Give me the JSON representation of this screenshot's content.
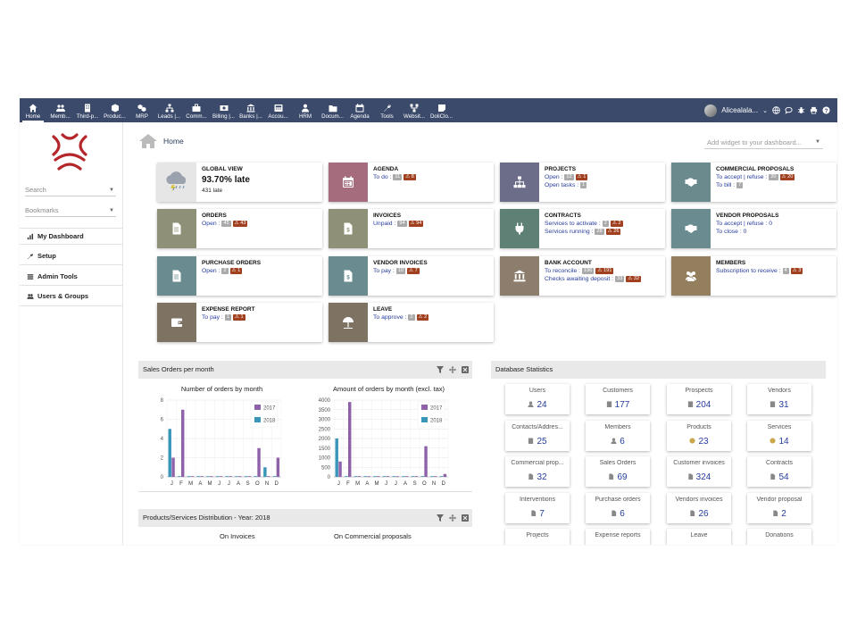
{
  "menu": [
    {
      "label": "Home",
      "icon": "home-icon",
      "active": true
    },
    {
      "label": "Memb...",
      "icon": "members-icon"
    },
    {
      "label": "Third-p...",
      "icon": "building-icon"
    },
    {
      "label": "Produc...",
      "icon": "cube-icon"
    },
    {
      "label": "MRP",
      "icon": "cubes-icon"
    },
    {
      "label": "Leads |...",
      "icon": "sitemap-icon"
    },
    {
      "label": "Comm...",
      "icon": "briefcase-icon"
    },
    {
      "label": "Billing |...",
      "icon": "money-icon"
    },
    {
      "label": "Banks |...",
      "icon": "bank-icon"
    },
    {
      "label": "Accou...",
      "icon": "calculator-icon"
    },
    {
      "label": "HRM",
      "icon": "user-tie-icon"
    },
    {
      "label": "Docum...",
      "icon": "folder-icon"
    },
    {
      "label": "Agenda",
      "icon": "calendar-icon"
    },
    {
      "label": "Tools",
      "icon": "wrench-icon"
    },
    {
      "label": "Websit...",
      "icon": "globe-sitemap-icon"
    },
    {
      "label": "DoliClo...",
      "icon": "sticky-note-icon"
    }
  ],
  "user": {
    "name": "Alicealala..."
  },
  "sidebar": {
    "search_placeholder": "Search",
    "bookmarks_label": "Bookmarks",
    "links": [
      {
        "label": "My Dashboard",
        "icon": "chart-icon"
      },
      {
        "label": "Setup",
        "icon": "wrench-icon"
      },
      {
        "label": "Admin Tools",
        "icon": "list-icon"
      },
      {
        "label": "Users & Groups",
        "icon": "users-icon"
      }
    ]
  },
  "header": {
    "title": "Home",
    "widget_placeholder": "Add widget to your dashboard..."
  },
  "global_view": {
    "title": "GLOBAL VIEW",
    "value": "93.70% late",
    "sub": "431 late"
  },
  "boxes": [
    {
      "title": "AGENDA",
      "color": "#a46c7d",
      "icon": "calendar-icon",
      "lines": [
        {
          "text": "To do :",
          "gray": "11",
          "red": "8"
        }
      ]
    },
    {
      "title": "PROJECTS",
      "color": "#6c6d88",
      "icon": "sitemap-icon",
      "lines": [
        {
          "text": "Open :",
          "gray": "12",
          "red": "1"
        },
        {
          "text": "Open tasks :",
          "gray": "1",
          "red": ""
        }
      ]
    },
    {
      "title": "COMMERCIAL PROPOSALS",
      "color": "#6b8a8e",
      "icon": "handshake-icon",
      "lines": [
        {
          "text": "To accept | refuse :",
          "gray": "20",
          "red": "20"
        },
        {
          "text": "To bill :",
          "gray": "7",
          "red": ""
        }
      ]
    },
    {
      "title": "ORDERS",
      "color": "#8e9177",
      "icon": "file-icon",
      "lines": [
        {
          "text": "Open :",
          "gray": "45",
          "red": "43"
        }
      ]
    },
    {
      "title": "INVOICES",
      "color": "#8e9177",
      "icon": "invoice-icon",
      "lines": [
        {
          "text": "Unpaid :",
          "gray": "94",
          "red": "94"
        }
      ]
    },
    {
      "title": "CONTRACTS",
      "color": "#5e8075",
      "icon": "plug-icon",
      "lines": [
        {
          "text": "Services to activate :",
          "gray": "2",
          "red": "2"
        },
        {
          "text": "Services running :",
          "gray": "28",
          "red": "26"
        }
      ]
    },
    {
      "title": "VENDOR PROPOSALS",
      "color": "#6a8b8f",
      "icon": "handshake-icon",
      "lines": [
        {
          "text": "To accept | refuse : 0",
          "gray": "",
          "red": ""
        },
        {
          "text": "To close : 0",
          "gray": "",
          "red": ""
        }
      ]
    },
    {
      "title": "PURCHASE ORDERS",
      "color": "#6a8b8f",
      "icon": "file-icon",
      "lines": [
        {
          "text": "Open :",
          "gray": "2",
          "red": "1"
        }
      ]
    },
    {
      "title": "VENDOR INVOICES",
      "color": "#6a8b8f",
      "icon": "invoice-icon",
      "lines": [
        {
          "text": "To pay :",
          "gray": "10",
          "red": "7"
        }
      ]
    },
    {
      "title": "BANK ACCOUNT",
      "color": "#8c7d6c",
      "icon": "bank-icon",
      "lines": [
        {
          "text": "To reconcile :",
          "gray": "196",
          "red": "191"
        },
        {
          "text": "Checks awaiting deposit :",
          "gray": "33",
          "red": "32"
        }
      ]
    },
    {
      "title": "MEMBERS",
      "color": "#937e5e",
      "icon": "members-icon",
      "lines": [
        {
          "text": "Subscription to receive :",
          "gray": "4",
          "red": "3"
        }
      ]
    },
    {
      "title": "EXPENSE REPORT",
      "color": "#7e7363",
      "icon": "wallet-icon",
      "lines": [
        {
          "text": "To pay :",
          "gray": "1",
          "red": "1"
        }
      ]
    },
    {
      "title": "LEAVE",
      "color": "#7e7363",
      "icon": "umbrella-icon",
      "lines": [
        {
          "text": "To approve :",
          "gray": "2",
          "red": "2"
        }
      ]
    }
  ],
  "sales_panel": {
    "title": "Sales Orders per month"
  },
  "dist_panel": {
    "title": "Products/Services Distribution - Year: 2018",
    "col1": "On Invoices",
    "col2": "On Commercial proposals"
  },
  "stats_panel": {
    "title": "Database Statistics"
  },
  "stats": [
    {
      "label": "Users",
      "value": "24",
      "icon": "user-icon"
    },
    {
      "label": "Customers",
      "value": "177",
      "icon": "building-icon"
    },
    {
      "label": "Prospects",
      "value": "204",
      "icon": "building-icon"
    },
    {
      "label": "Vendors",
      "value": "31",
      "icon": "building-icon"
    },
    {
      "label": "Contacts/Addres...",
      "value": "25",
      "icon": "contact-icon"
    },
    {
      "label": "Members",
      "value": "6",
      "icon": "user-icon"
    },
    {
      "label": "Products",
      "value": "23",
      "icon": "cube-icon"
    },
    {
      "label": "Services",
      "value": "14",
      "icon": "cube-icon"
    },
    {
      "label": "Commercial prop...",
      "value": "32",
      "icon": "file-icon"
    },
    {
      "label": "Sales Orders",
      "value": "69",
      "icon": "file-icon"
    },
    {
      "label": "Customer invoices",
      "value": "324",
      "icon": "file-icon"
    },
    {
      "label": "Contracts",
      "value": "54",
      "icon": "file-icon"
    },
    {
      "label": "Interventions",
      "value": "7",
      "icon": "file-icon"
    },
    {
      "label": "Purchase orders",
      "value": "6",
      "icon": "file-icon"
    },
    {
      "label": "Vendors invoices",
      "value": "26",
      "icon": "file-icon"
    },
    {
      "label": "Vendor proposal",
      "value": "2",
      "icon": "file-icon"
    },
    {
      "label": "Projects",
      "value": "",
      "icon": ""
    },
    {
      "label": "Expense reports",
      "value": "",
      "icon": ""
    },
    {
      "label": "Leave",
      "value": "",
      "icon": ""
    },
    {
      "label": "Donations",
      "value": "",
      "icon": ""
    }
  ],
  "chart_data": [
    {
      "type": "bar",
      "title": "Number of orders by month",
      "categories": [
        "J",
        "F",
        "M",
        "A",
        "M",
        "J",
        "J",
        "A",
        "S",
        "O",
        "N",
        "D"
      ],
      "ylim": [
        0,
        8
      ],
      "yticks": [
        "0",
        "2",
        "4",
        "6",
        "8"
      ],
      "series": [
        {
          "name": "2017",
          "color": "#8e62a9",
          "values": [
            2,
            7,
            0,
            0,
            0,
            0,
            0,
            0,
            0,
            3,
            0,
            2
          ]
        },
        {
          "name": "2018",
          "color": "#3a96b9",
          "values": [
            5,
            0,
            0,
            0,
            0,
            0,
            0,
            0,
            0,
            0,
            1,
            0
          ]
        }
      ]
    },
    {
      "type": "bar",
      "title": "Amount of orders by month (excl. tax)",
      "categories": [
        "J",
        "F",
        "M",
        "A",
        "M",
        "J",
        "J",
        "A",
        "S",
        "O",
        "N",
        "D"
      ],
      "ylim": [
        0,
        4000
      ],
      "yticks": [
        "0",
        "500",
        "1000",
        "1500",
        "2000",
        "2500",
        "3000",
        "3500",
        "4000"
      ],
      "series": [
        {
          "name": "2017",
          "color": "#8e62a9",
          "values": [
            800,
            3900,
            0,
            0,
            0,
            0,
            0,
            0,
            0,
            1600,
            0,
            150
          ]
        },
        {
          "name": "2018",
          "color": "#3a96b9",
          "values": [
            2000,
            0,
            0,
            0,
            0,
            0,
            0,
            0,
            0,
            0,
            30,
            0
          ]
        }
      ]
    }
  ]
}
